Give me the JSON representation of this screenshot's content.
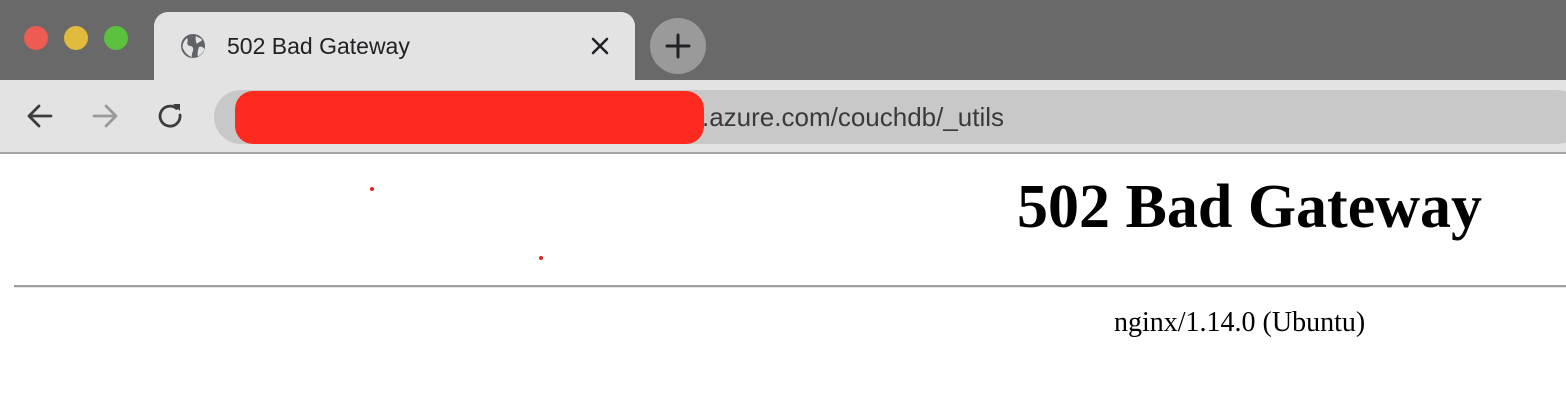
{
  "tab": {
    "title": "502 Bad Gateway",
    "favicon": "globe-icon",
    "close_icon": "close-icon"
  },
  "toolbar": {
    "new_tab_icon": "plus-icon",
    "back_icon": "arrow-left-icon",
    "forward_icon": "arrow-right-icon",
    "reload_icon": "reload-icon",
    "url_visible_text": ".azure.com/couchdb/_utils",
    "url_redaction_color": "#ff2a1f"
  },
  "page": {
    "heading": "502 Bad Gateway",
    "server_info": "nginx/1.14.0 (Ubuntu)"
  },
  "colors": {
    "tabstrip_bg": "#696969",
    "toolbar_bg": "#e3e3e3",
    "close_red": "#ee5b52",
    "minimize_yellow": "#e1bc3c",
    "maximize_green": "#5cc13f"
  }
}
